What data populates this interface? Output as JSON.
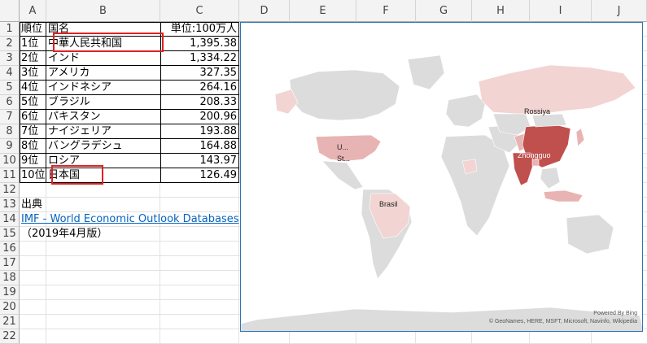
{
  "columns": [
    "A",
    "B",
    "C",
    "D",
    "E",
    "F",
    "G",
    "H",
    "I",
    "J"
  ],
  "rows": [
    "1",
    "2",
    "3",
    "4",
    "5",
    "6",
    "7",
    "8",
    "9",
    "10",
    "11",
    "12",
    "13",
    "14",
    "15",
    "16",
    "17",
    "18",
    "19",
    "20",
    "21",
    "22"
  ],
  "table": {
    "header": {
      "rank": "順位",
      "country": "国名",
      "value": "単位:100万人"
    },
    "data": [
      {
        "rank": "1位",
        "country": "中華人民共和国",
        "value": "1,395.38"
      },
      {
        "rank": "2位",
        "country": "インド",
        "value": "1,334.22"
      },
      {
        "rank": "3位",
        "country": "アメリカ",
        "value": "327.35"
      },
      {
        "rank": "4位",
        "country": "インドネシア",
        "value": "264.16"
      },
      {
        "rank": "5位",
        "country": "ブラジル",
        "value": "208.33"
      },
      {
        "rank": "6位",
        "country": "パキスタン",
        "value": "200.96"
      },
      {
        "rank": "7位",
        "country": "ナイジェリア",
        "value": "193.88"
      },
      {
        "rank": "8位",
        "country": "バングラデシュ",
        "value": "164.88"
      },
      {
        "rank": "9位",
        "country": "ロシア",
        "value": "143.97"
      },
      {
        "rank": "10位",
        "country": "日本国",
        "value": "126.49"
      }
    ]
  },
  "source": {
    "label": "出典",
    "link_text": "IMF - World Economic Outlook Databases",
    "note": "（2019年4月版）"
  },
  "map": {
    "labels": {
      "russia": "Rossiya",
      "china": "Zhongguo",
      "brazil": "Brasil",
      "usa_1": "U...",
      "usa_2": "St..."
    },
    "powered": "Powered By Bing",
    "credit": "© GeoNames, HERE, MSFT, Microsoft, Navinfo, Wikipedia",
    "colors": {
      "land": "#dcdcdc",
      "high": "#c0504d",
      "mid": "#e8b4b3",
      "low": "#f2d4d3"
    }
  }
}
